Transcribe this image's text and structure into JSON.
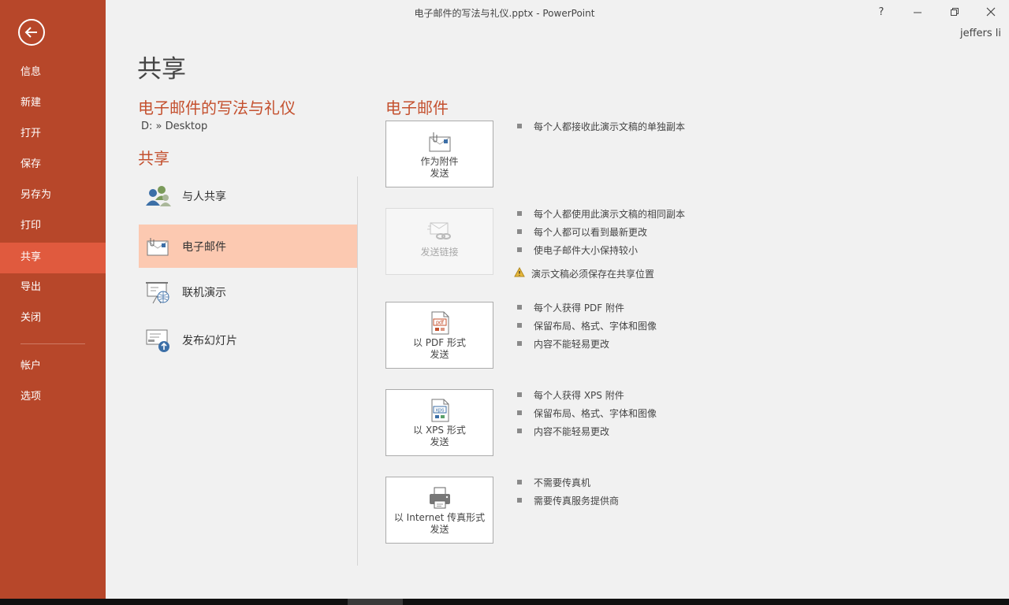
{
  "window": {
    "title": "电子邮件的写法与礼仪.pptx - PowerPoint",
    "help_label": "?",
    "user": "jeffers li"
  },
  "sidebar": {
    "items": [
      {
        "label": "信息"
      },
      {
        "label": "新建"
      },
      {
        "label": "打开"
      },
      {
        "label": "保存"
      },
      {
        "label": "另存为"
      },
      {
        "label": "打印"
      },
      {
        "label": "共享"
      },
      {
        "label": "导出"
      },
      {
        "label": "关闭"
      },
      {
        "label": "帐户"
      },
      {
        "label": "选项"
      }
    ],
    "active": "共享"
  },
  "page": {
    "title": "共享",
    "doc_title": "电子邮件的写法与礼仪",
    "doc_path": "D: » Desktop",
    "share_heading": "共享"
  },
  "share_options": [
    {
      "label": "与人共享",
      "icon": "people-icon"
    },
    {
      "label": "电子邮件",
      "icon": "email-icon"
    },
    {
      "label": "联机演示",
      "icon": "online-present-icon"
    },
    {
      "label": "发布幻灯片",
      "icon": "publish-slides-icon"
    }
  ],
  "email": {
    "heading": "电子邮件",
    "actions": [
      {
        "line1": "作为附件",
        "line2": "发送",
        "icon": "attachment-icon",
        "enabled": true,
        "bullets": [
          "每个人都接收此演示文稿的单独副本"
        ]
      },
      {
        "line1": "发送链接",
        "line2": "",
        "icon": "link-icon",
        "enabled": false,
        "bullets": [
          "每个人都使用此演示文稿的相同副本",
          "每个人都可以看到最新更改",
          "使电子邮件大小保持较小"
        ],
        "warning": "演示文稿必须保存在共享位置"
      },
      {
        "line1": "以 PDF 形式",
        "line2": "发送",
        "icon": "pdf-icon",
        "enabled": true,
        "bullets": [
          "每个人获得 PDF 附件",
          "保留布局、格式、字体和图像",
          "内容不能轻易更改"
        ]
      },
      {
        "line1": "以 XPS 形式",
        "line2": "发送",
        "icon": "xps-icon",
        "enabled": true,
        "bullets": [
          "每个人获得 XPS 附件",
          "保留布局、格式、字体和图像",
          "内容不能轻易更改"
        ]
      },
      {
        "line1": "以 Internet 传真形式",
        "line2": "发送",
        "icon": "fax-icon",
        "enabled": true,
        "bullets": [
          "不需要传真机",
          "需要传真服务提供商"
        ]
      }
    ]
  },
  "colors": {
    "sidebar": "#b7472a",
    "sidebar_active": "#e05a3e",
    "accent_text": "#c4502e",
    "selected_option": "#fcc9b1"
  }
}
